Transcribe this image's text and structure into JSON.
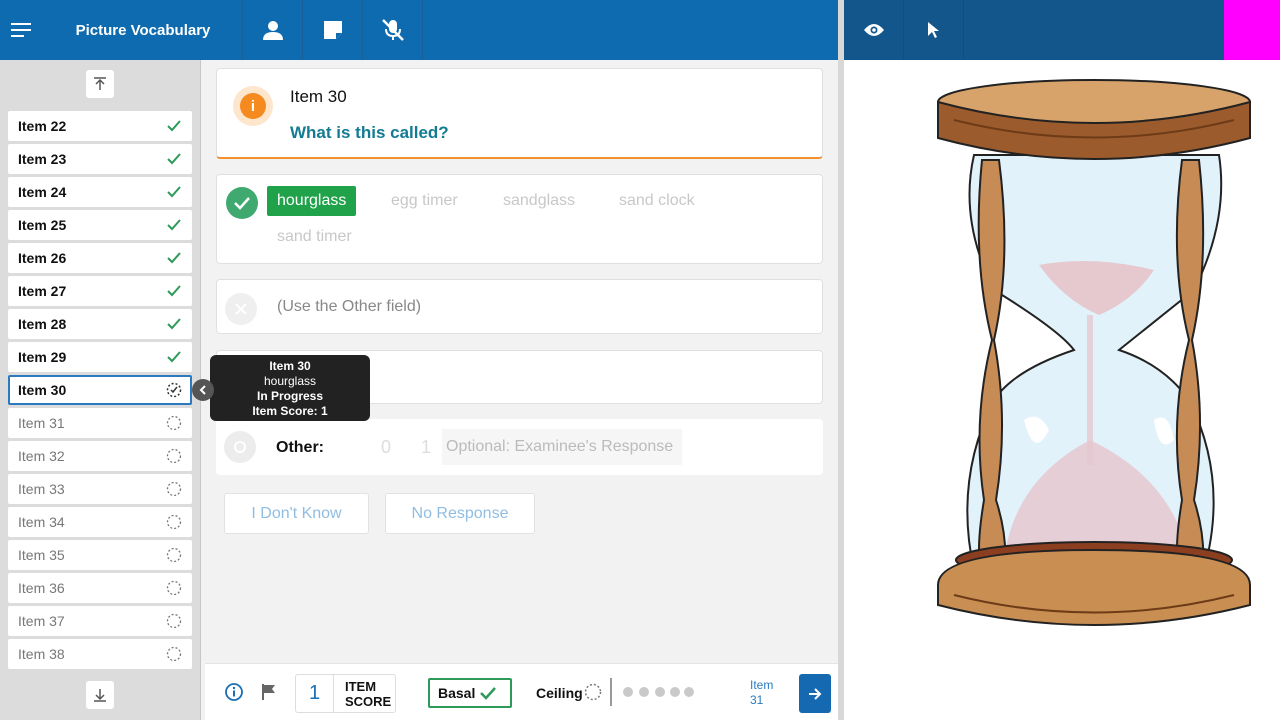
{
  "header": {
    "title": "Picture Vocabulary",
    "icons": [
      "menu-icon",
      "examinee-icon",
      "notes-icon",
      "mic-off-icon"
    ],
    "right_icons": [
      "eye-icon",
      "pointer-icon"
    ]
  },
  "sidebar": {
    "items": [
      {
        "label": "Item 22",
        "status": "complete"
      },
      {
        "label": "Item 23",
        "status": "complete"
      },
      {
        "label": "Item 24",
        "status": "complete"
      },
      {
        "label": "Item 25",
        "status": "complete"
      },
      {
        "label": "Item 26",
        "status": "complete"
      },
      {
        "label": "Item 27",
        "status": "complete"
      },
      {
        "label": "Item 28",
        "status": "complete"
      },
      {
        "label": "Item 29",
        "status": "complete"
      },
      {
        "label": "Item 30",
        "status": "in-progress"
      },
      {
        "label": "Item 31",
        "status": "not-started"
      },
      {
        "label": "Item 32",
        "status": "not-started"
      },
      {
        "label": "Item 33",
        "status": "not-started"
      },
      {
        "label": "Item 34",
        "status": "not-started"
      },
      {
        "label": "Item 35",
        "status": "not-started"
      },
      {
        "label": "Item 36",
        "status": "not-started"
      },
      {
        "label": "Item 37",
        "status": "not-started"
      },
      {
        "label": "Item 38",
        "status": "not-started"
      }
    ]
  },
  "tooltip": {
    "title": "Item 30",
    "answer": "hourglass",
    "status": "In Progress",
    "score": "Item Score: 1"
  },
  "main": {
    "item_title": "Item 30",
    "question": "What is this called?",
    "answers": [
      "hourglass",
      "egg timer",
      "sandglass",
      "sand clock",
      "sand timer"
    ],
    "selected_answer": "hourglass",
    "other_field_hint": "(Use the Other field)",
    "other_label": "Other:",
    "other_scores": [
      "0",
      "1"
    ],
    "other_placeholder": "Optional: Examinee's Response",
    "dont_know_label": "I Don't Know",
    "no_response_label": "No Response"
  },
  "footer": {
    "item_score": "1",
    "item_score_label_1": "ITEM",
    "item_score_label_2": "SCORE",
    "basal_label": "Basal",
    "ceiling_label": "Ceiling",
    "next_item_line1": "Item",
    "next_item_line2": "31"
  },
  "colors": {
    "header": "#0e6bb0",
    "header_right": "#12568b",
    "selected_answer": "#1fa24a",
    "accent_orange": "#f58a1f",
    "question": "#137b93",
    "magenta": "#ff00ff"
  }
}
